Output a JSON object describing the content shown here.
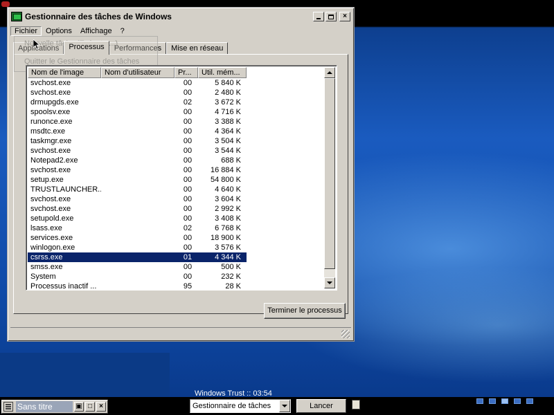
{
  "window": {
    "title": "Gestionnaire des tâches de Windows",
    "controls": {
      "minimize": "_",
      "maximize": "□",
      "close": "×"
    }
  },
  "menubar": {
    "items": [
      "Fichier",
      "Options",
      "Affichage",
      "?"
    ]
  },
  "file_menu_ghost": {
    "items": [
      "Nouvelle tâche (Exécuter...)",
      "Quitter le Gestionnaire des tâches"
    ]
  },
  "tabs": [
    {
      "label": "Applications",
      "active": false
    },
    {
      "label": "Processus",
      "active": true
    },
    {
      "label": "Performances",
      "active": false
    },
    {
      "label": "Mise en réseau",
      "active": false
    }
  ],
  "process_table": {
    "columns": [
      "Nom de l'image",
      "Nom d'utilisateur",
      "Pr...",
      "Util. mém..."
    ],
    "rows": [
      {
        "name": "svchost.exe",
        "user": "",
        "prio": "00",
        "mem": "5 840 K"
      },
      {
        "name": "svchost.exe",
        "user": "",
        "prio": "00",
        "mem": "2 480 K"
      },
      {
        "name": "drmupgds.exe",
        "user": "",
        "prio": "02",
        "mem": "3 672 K"
      },
      {
        "name": "spoolsv.exe",
        "user": "",
        "prio": "00",
        "mem": "4 716 K"
      },
      {
        "name": "runonce.exe",
        "user": "",
        "prio": "00",
        "mem": "3 388 K"
      },
      {
        "name": "msdtc.exe",
        "user": "",
        "prio": "00",
        "mem": "4 364 K"
      },
      {
        "name": "taskmgr.exe",
        "user": "",
        "prio": "00",
        "mem": "3 504 K"
      },
      {
        "name": "svchost.exe",
        "user": "",
        "prio": "00",
        "mem": "3 544 K"
      },
      {
        "name": "Notepad2.exe",
        "user": "",
        "prio": "00",
        "mem": "688 K"
      },
      {
        "name": "svchost.exe",
        "user": "",
        "prio": "00",
        "mem": "16 884 K"
      },
      {
        "name": "setup.exe",
        "user": "",
        "prio": "00",
        "mem": "54 800 K"
      },
      {
        "name": "TRUSTLAUNCHER...",
        "user": "",
        "prio": "00",
        "mem": "4 640 K"
      },
      {
        "name": "svchost.exe",
        "user": "",
        "prio": "00",
        "mem": "3 604 K"
      },
      {
        "name": "svchost.exe",
        "user": "",
        "prio": "00",
        "mem": "2 992 K"
      },
      {
        "name": "setupold.exe",
        "user": "",
        "prio": "00",
        "mem": "3 408 K"
      },
      {
        "name": "lsass.exe",
        "user": "",
        "prio": "02",
        "mem": "6 768 K"
      },
      {
        "name": "services.exe",
        "user": "",
        "prio": "00",
        "mem": "18 900 K"
      },
      {
        "name": "winlogon.exe",
        "user": "",
        "prio": "00",
        "mem": "3 576 K"
      },
      {
        "name": "csrss.exe",
        "user": "",
        "prio": "01",
        "mem": "4 344 K",
        "selected": true
      },
      {
        "name": "smss.exe",
        "user": "",
        "prio": "00",
        "mem": "500 K"
      },
      {
        "name": "System",
        "user": "",
        "prio": "00",
        "mem": "232 K"
      },
      {
        "name": "Processus inactif ...",
        "user": "",
        "prio": "95",
        "mem": "28 K"
      }
    ]
  },
  "end_process_label": "Terminer le processus",
  "taskbar": {
    "task_title": "Sans titre",
    "clock_label": "Windows Trust :: 03:54",
    "select_value": "Gestionnaire de tâches",
    "launch_label": "Lancer",
    "desktops": [
      false,
      false,
      true,
      false,
      false
    ]
  },
  "colors": {
    "selection": "#0a246a",
    "window_face": "#d4d0c8",
    "desktop_blue": "#1a5bbf"
  }
}
